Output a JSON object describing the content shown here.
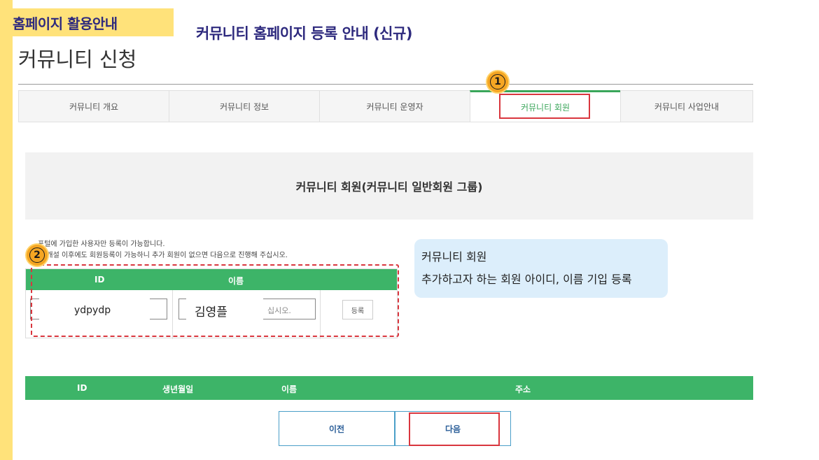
{
  "guide": {
    "tag": "홈페이지 활용안내",
    "title": "커뮤니티 홈페이지 등록 안내 (신규)"
  },
  "page": {
    "title": "커뮤니티 신청"
  },
  "tabs": [
    {
      "label": "커뮤니티 개요",
      "active": false
    },
    {
      "label": "커뮤니티 정보",
      "active": false
    },
    {
      "label": "커뮤니티 운영자",
      "active": false
    },
    {
      "label": "커뮤니티 회원",
      "active": true
    },
    {
      "label": "커뮤니티 사업안내",
      "active": false
    }
  ],
  "badges": {
    "step1": "1",
    "step2": "2"
  },
  "section": {
    "heading": "커뮤니티 회원(커뮤니티 일반회원 그룹)"
  },
  "notes": [
    "포털에 가입한 사용자만 등록이 가능합니다.",
    "티 개설 이후에도 회원등록이 가능하니 추가 회원이 없으면 다음으로 진행해 주십시오."
  ],
  "add_table": {
    "col_id": "ID",
    "col_name": "이름",
    "id_value": "ydpydp",
    "name_value": "김영플",
    "name_placeholder_tail": "십시오.",
    "register_label": "등록"
  },
  "callout": {
    "line1": "커뮤니티 회원",
    "line2": "추가하고자 하는 회원 아이디, 이름 기입 등록"
  },
  "list_table": {
    "headers": [
      "ID",
      "생년월일",
      "이름",
      "주소"
    ]
  },
  "buttons": {
    "prev": "이전",
    "next": "다음"
  },
  "colors": {
    "accent_green": "#3db468",
    "highlight_red": "#d9363e",
    "guide_yellow": "#ffe27a",
    "guide_navy": "#2e2a7e",
    "badge_orange": "#f5a623",
    "callout_blue": "#dceefb"
  }
}
